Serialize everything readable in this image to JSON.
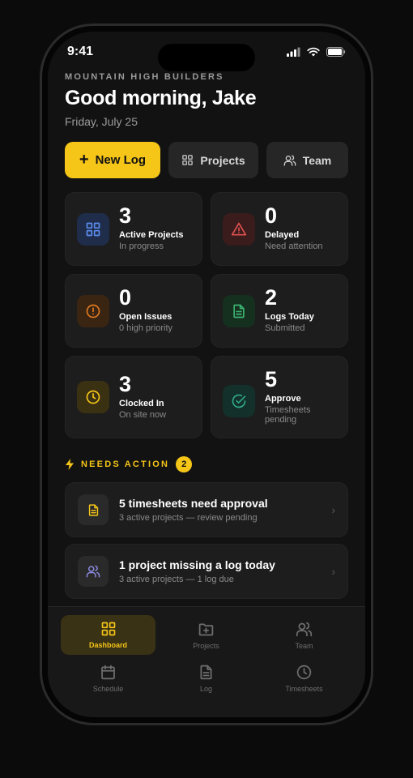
{
  "status": {
    "time": "9:41"
  },
  "header": {
    "company": "MOUNTAIN HIGH BUILDERS",
    "greeting": "Good morning, Jake",
    "date": "Friday, July 25"
  },
  "actions": {
    "new_log": "New Log",
    "projects": "Projects",
    "team": "Team"
  },
  "stats": [
    {
      "value": "3",
      "label": "Active Projects",
      "sub": "In progress",
      "icon": "grid-icon",
      "color": "#5b8def",
      "bg": "#1f2d4a"
    },
    {
      "value": "0",
      "label": "Delayed",
      "sub": "Need attention",
      "icon": "alert-triangle-icon",
      "color": "#e05050",
      "bg": "#3a1c1c"
    },
    {
      "value": "0",
      "label": "Open Issues",
      "sub": "0 high priority",
      "icon": "alert-circle-icon",
      "color": "#e07a20",
      "bg": "#3a2512"
    },
    {
      "value": "2",
      "label": "Logs Today",
      "sub": "Submitted",
      "icon": "document-icon",
      "color": "#3cb371",
      "bg": "#15301f"
    },
    {
      "value": "3",
      "label": "Clocked In",
      "sub": "On site now",
      "icon": "clock-icon",
      "color": "#f5c518",
      "bg": "#3a3012"
    },
    {
      "value": "5",
      "label": "Approve",
      "sub": "Timesheets pending",
      "icon": "check-circle-icon",
      "color": "#2fa88a",
      "bg": "#13302a"
    }
  ],
  "needs_action": {
    "title": "NEEDS ACTION",
    "count": "2",
    "items": [
      {
        "title": "5 timesheets need approval",
        "sub": "3 active projects — review pending",
        "icon": "document-icon"
      },
      {
        "title": "1 project missing a log today",
        "sub": "3 active projects — 1 log due",
        "icon": "users-icon"
      }
    ]
  },
  "tabs": [
    {
      "label": "Dashboard",
      "icon": "dashboard-icon",
      "active": true
    },
    {
      "label": "Projects",
      "icon": "folder-plus-icon",
      "active": false
    },
    {
      "label": "Team",
      "icon": "users-icon",
      "active": false
    },
    {
      "label": "Schedule",
      "icon": "calendar-icon",
      "active": false
    },
    {
      "label": "Log",
      "icon": "document-icon",
      "active": false
    },
    {
      "label": "Timesheets",
      "icon": "clock-icon",
      "active": false
    }
  ],
  "colors": {
    "accent": "#f5c518",
    "background": "#121212",
    "card": "#1d1d1d"
  }
}
